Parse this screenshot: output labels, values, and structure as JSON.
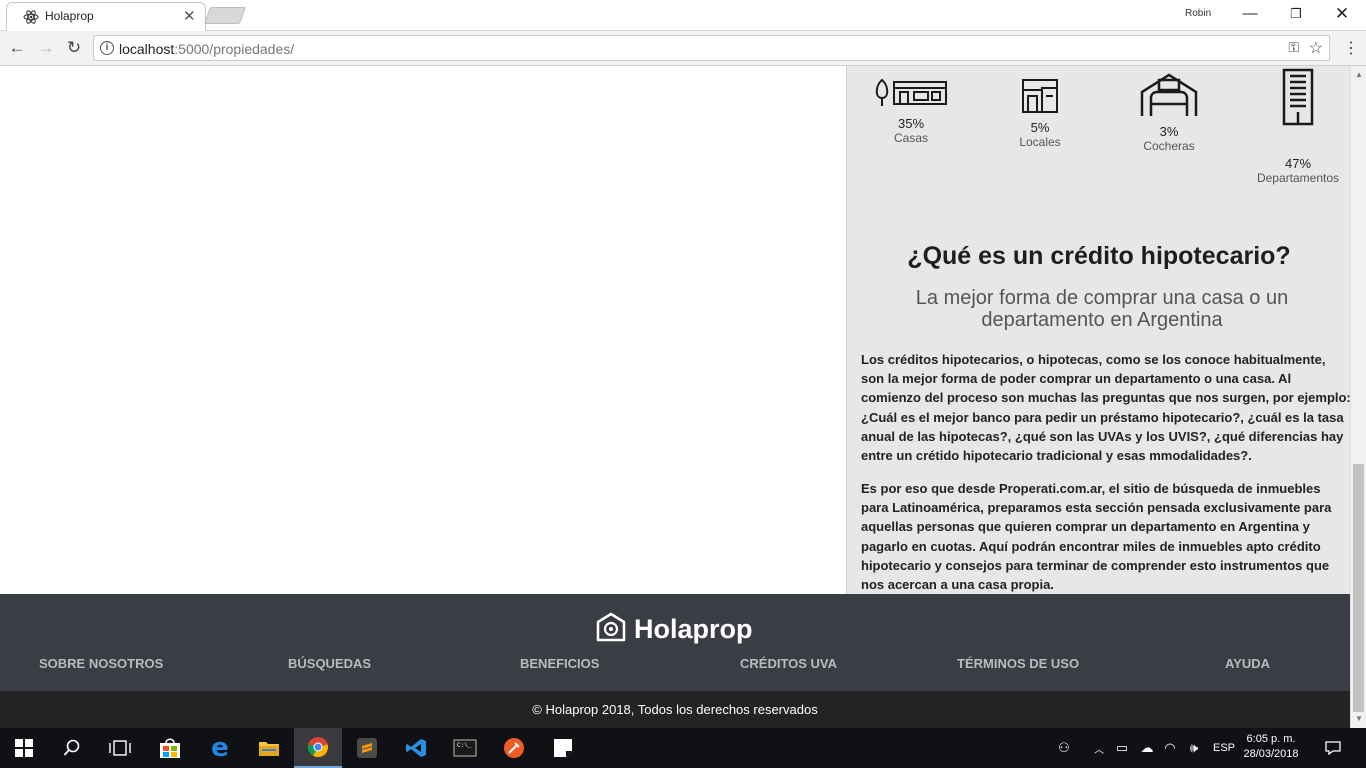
{
  "browser": {
    "tab_title": "Holaprop",
    "profile_name": "Robin",
    "url_host": "localhost",
    "url_rest": ":5000/propiedades/"
  },
  "stats": [
    {
      "percent": "35%",
      "label": "Casas",
      "icon": "house-icon"
    },
    {
      "percent": "5%",
      "label": "Locales",
      "icon": "store-icon"
    },
    {
      "percent": "3%",
      "label": "Cocheras",
      "icon": "garage-icon"
    },
    {
      "percent": "47%",
      "label": "Departamentos",
      "icon": "building-icon"
    }
  ],
  "credit": {
    "title": "¿Qué es un crédito hipotecario?",
    "subtitle": "La mejor forma de comprar una casa o un departamento en Argentina",
    "paragraph1": "Los créditos hipotecarios, o hipotecas, como se los conoce habitualmente, son la mejor forma de poder comprar un departamento o una casa. Al comienzo del proceso son muchas las preguntas que nos surgen, por ejemplo: ¿Cuál es el mejor banco para pedir un préstamo hipotecario?, ¿cuál es la tasa anual de las hipotecas?, ¿qué son las UVAs y los UVIS?, ¿qué diferencias hay entre un crétido hipotecario tradicional y esas mmodalidades?.",
    "paragraph2": "Es por eso que desde Properati.com.ar, el sitio de búsqueda de inmuebles para Latinoamérica, preparamos esta sección pensada exclusivamente para aquellas personas que quieren comprar un departamento en Argentina y pagarlo en cuotas. Aquí podrán encontrar miles de inmuebles apto crédito hipotecario y consejos para terminar de comprender esto instrumentos que nos acercan a una casa propia."
  },
  "footer": {
    "brand": "Holaprop",
    "links": [
      "SOBRE NOSOTROS",
      "BÚSQUEDAS",
      "BENEFICIOS",
      "CRÉDITOS UVA",
      "TÉRMINOS DE USO",
      "AYUDA"
    ],
    "copyright": "© Holaprop 2018, Todos los derechos reservados"
  },
  "taskbar": {
    "language": "ESP",
    "time": "6:05 p. m.",
    "date": "28/03/2018"
  },
  "colors": {
    "panel": "#e6e7e9",
    "footer": "#3b3d45",
    "footer_bottom": "#232325",
    "taskbar": "#101114"
  }
}
